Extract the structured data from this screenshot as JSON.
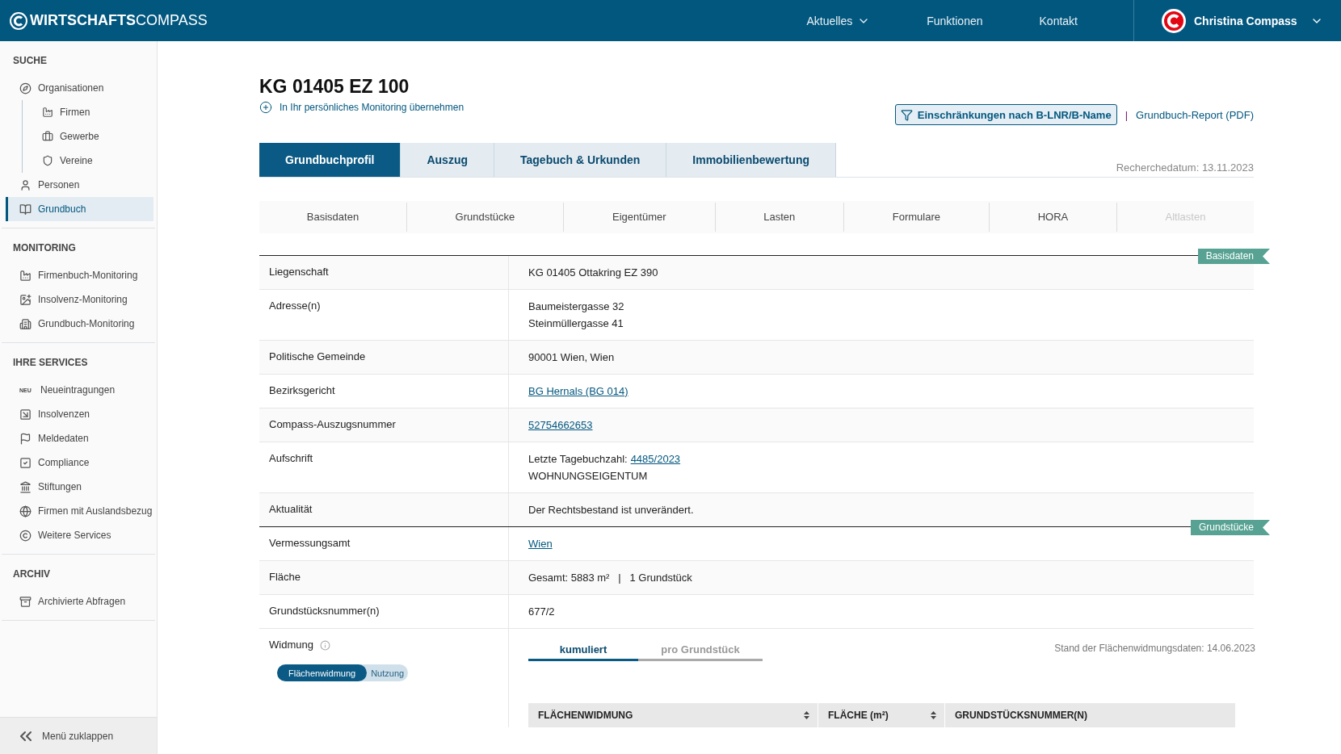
{
  "header": {
    "brand_bold": "WIRTSCHAFTS",
    "brand_light": "COMPASS",
    "nav": [
      {
        "label": "Aktuelles",
        "dropdown": true
      },
      {
        "label": "Funktionen",
        "dropdown": false
      },
      {
        "label": "Kontakt",
        "dropdown": false
      }
    ],
    "user": "Christina Compass"
  },
  "sidebar": {
    "sections": [
      {
        "title": "SUCHE",
        "items": [
          {
            "label": "Organisationen",
            "selected": false,
            "children": [
              {
                "label": "Firmen",
                "selected": false
              },
              {
                "label": "Gewerbe",
                "selected": false
              },
              {
                "label": "Vereine",
                "selected": false
              }
            ]
          },
          {
            "label": "Personen",
            "selected": false
          },
          {
            "label": "Grundbuch",
            "selected": true
          }
        ]
      },
      {
        "title": "MONITORING",
        "items": [
          {
            "label": "Firmenbuch-Monitoring",
            "selected": false
          },
          {
            "label": "Insolvenz-Monitoring",
            "selected": false
          },
          {
            "label": "Grundbuch-Monitoring",
            "selected": false
          }
        ]
      },
      {
        "title": "IHRE SERVICES",
        "items": [
          {
            "label": "Neueintragungen",
            "badge": "NEU",
            "selected": false
          },
          {
            "label": "Insolvenzen",
            "selected": false
          },
          {
            "label": "Meldedaten",
            "selected": false
          },
          {
            "label": "Compliance",
            "selected": false
          },
          {
            "label": "Stiftungen",
            "selected": false
          },
          {
            "label": "Firmen mit Auslandsbezug",
            "selected": false
          },
          {
            "label": "Weitere Services",
            "selected": false
          }
        ]
      },
      {
        "title": "ARCHIV",
        "items": [
          {
            "label": "Archivierte Abfragen",
            "selected": false
          }
        ]
      }
    ],
    "collapse": "Menü zuklappen"
  },
  "page": {
    "title": "KG 01405 EZ 100",
    "monitoring_link": "In Ihr persönliches Monitoring übernehmen",
    "filter_button": "Einschränkungen nach B-LNR/B-Name",
    "separator": "|",
    "report_link": "Grundbuch-Report (PDF)",
    "research_date": "Recherchedatum: 13.11.2023"
  },
  "tabs": [
    {
      "label": "Grundbuchprofil",
      "selected": true
    },
    {
      "label": "Auszug",
      "selected": false
    },
    {
      "label": "Tagebuch & Urkunden",
      "selected": false
    },
    {
      "label": "Immobilienbewertung",
      "selected": false
    }
  ],
  "subtabs": [
    {
      "label": "Basisdaten",
      "disabled": false
    },
    {
      "label": "Grundstücke",
      "disabled": false
    },
    {
      "label": "Eigentümer",
      "disabled": false
    },
    {
      "label": "Lasten",
      "disabled": false
    },
    {
      "label": "Formulare",
      "disabled": false
    },
    {
      "label": "HORA",
      "disabled": false
    },
    {
      "label": "Altlasten",
      "disabled": true
    }
  ],
  "sections": [
    {
      "tag": "Basisdaten",
      "rows": [
        {
          "kind": "text",
          "label": "Liegenschaft",
          "lines": [
            {
              "text": "KG 01405 Ottakring EZ 390"
            }
          ]
        },
        {
          "kind": "text",
          "label": "Adresse(n)",
          "lines": [
            {
              "text": "Baumeistergasse 32"
            },
            {
              "text": "Steinmüllergasse 41"
            }
          ]
        },
        {
          "kind": "text",
          "label": "Politische Gemeinde",
          "lines": [
            {
              "text": "90001 Wien, Wien"
            }
          ]
        },
        {
          "kind": "text",
          "label": "Bezirksgericht",
          "lines": [
            {
              "link": "BG Hernals (BG 014)"
            }
          ]
        },
        {
          "kind": "text",
          "label": "Compass-Auszugsnummer",
          "lines": [
            {
              "link": "52754662653"
            }
          ]
        },
        {
          "kind": "text",
          "label": "Aufschrift",
          "lines": [
            {
              "text": "Letzte Tagebuchzahl:",
              "link": "4485/2023"
            },
            {
              "text": "WOHNUNGSEIGENTUM"
            }
          ]
        },
        {
          "kind": "text",
          "label": "Aktualität",
          "lines": [
            {
              "text": "Der Rechtsbestand ist unverändert."
            }
          ]
        }
      ]
    },
    {
      "tag": "Grundstücke",
      "rows": [
        {
          "kind": "text",
          "label": "Vermessungsamt",
          "lines": [
            {
              "link": "Wien"
            }
          ]
        },
        {
          "kind": "text",
          "label": "Fläche",
          "lines": [
            {
              "text": "Gesamt: 5883 m²   |   1 Grundstück"
            }
          ]
        },
        {
          "kind": "text",
          "label": "Grundstücksnummer(n)",
          "lines": [
            {
              "text": "677/2"
            }
          ]
        },
        {
          "kind": "widmung",
          "label": "Widmung",
          "toggle": [
            {
              "label": "Flächenwidmung",
              "selected": true
            },
            {
              "label": "Nutzung",
              "selected": false
            }
          ],
          "tabs": [
            {
              "label": "kumuliert",
              "selected": true
            },
            {
              "label": "pro Grundstück",
              "selected": false
            }
          ],
          "stand": "Stand der Flächenwidmungsdaten: 14.06.2023",
          "columns": [
            {
              "label": "FLÄCHENWIDMUNG",
              "sortable": true
            },
            {
              "label": "FLÄCHE (m²)",
              "sortable": true
            },
            {
              "label": "GRUNDSTÜCKSNUMMER(N)",
              "sortable": false
            }
          ]
        }
      ]
    }
  ]
}
